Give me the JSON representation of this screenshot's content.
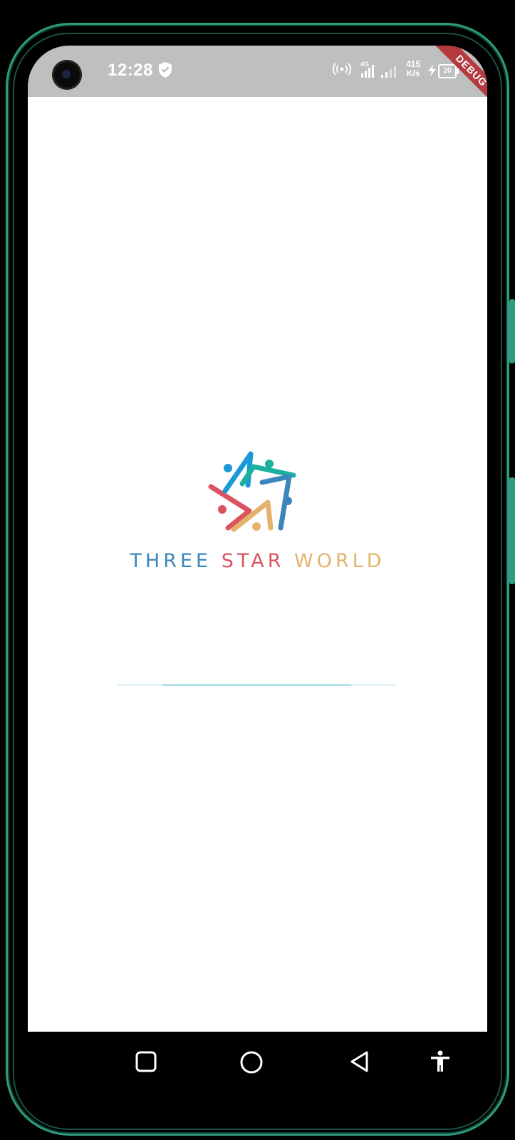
{
  "status_bar": {
    "time": "12:28",
    "network_speed_value": "415",
    "network_speed_unit": "K/s",
    "signal_type": "4G",
    "battery_level": "20",
    "icons": [
      "shield-icon",
      "hotspot-icon",
      "signal-icon",
      "signal-icon",
      "charging-icon",
      "battery-icon"
    ]
  },
  "debug_banner": "DEBUG",
  "splash": {
    "brand_words": [
      "THREE",
      "STAR",
      "WORLD"
    ],
    "brand_colors": {
      "three": "#3a86ba",
      "star": "#d9545f",
      "world": "#e5b26c"
    },
    "logo_colors": [
      "#d9545f",
      "#1a9ad6",
      "#1bb0a0",
      "#e5b26c",
      "#3a86ba"
    ],
    "loading_progress_fraction": 0.68,
    "progress_colors": {
      "track": "#e3f5f8",
      "fill": "#b3e3ea"
    }
  },
  "nav_bar": {
    "buttons": [
      "recent-apps-button",
      "home-button",
      "back-button",
      "accessibility-button"
    ]
  },
  "device": {
    "frame_color": "#2f9c7f"
  }
}
